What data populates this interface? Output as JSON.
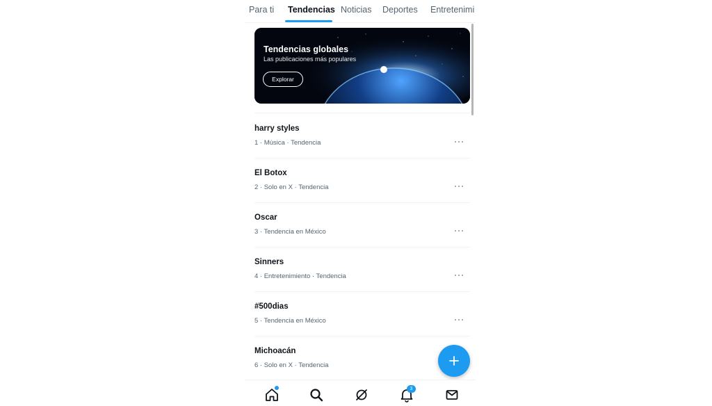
{
  "tabs": [
    {
      "label": "Para ti",
      "active": false
    },
    {
      "label": "Tendencias",
      "active": true
    },
    {
      "label": "Noticias",
      "active": false
    },
    {
      "label": "Deportes",
      "active": false
    },
    {
      "label": "Entretenimi",
      "active": false
    }
  ],
  "banner": {
    "title": "Tendencias globales",
    "subtitle": "Las publicaciones más populares",
    "button_label": "Explorar"
  },
  "trends": [
    {
      "name": "harry styles",
      "meta": "1 · Música · Tendencia"
    },
    {
      "name": "El Botox",
      "meta": "2 · Solo en X · Tendencia"
    },
    {
      "name": "Oscar",
      "meta": "3 · Tendencia en México"
    },
    {
      "name": "Sinners",
      "meta": "4 · Entretenimiento · Tendencia"
    },
    {
      "name": "#500dias",
      "meta": "5 · Tendencia en México"
    },
    {
      "name": "Michoacán",
      "meta": "6 · Solo en X · Tendencia"
    }
  ],
  "nav": {
    "items": [
      "home-icon",
      "search-icon",
      "grok-icon",
      "bell-icon",
      "mail-icon"
    ],
    "notification_count": "3"
  },
  "colors": {
    "accent": "#1d9bf0",
    "text": "#0f1419",
    "muted": "#536471"
  }
}
